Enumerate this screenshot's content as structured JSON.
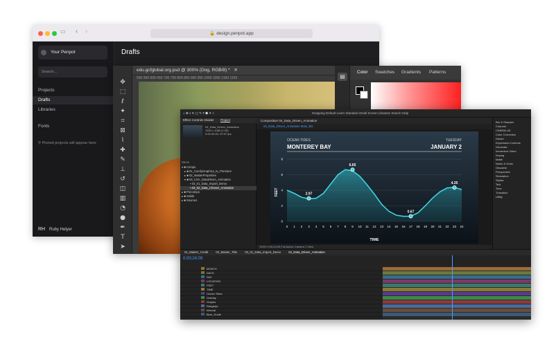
{
  "browser": {
    "url": "design.penpot.app",
    "accent_dots": [
      "#ff5f57",
      "#febc2e",
      "#28c840"
    ]
  },
  "penpot": {
    "team": "Your Penpot",
    "search_placeholder": "Search...",
    "nav": [
      "Projects",
      "Drafts",
      "Libraries"
    ],
    "fonts_label": "Fonts",
    "pinned_text": "Pinned projects will appear here",
    "page_title": "Drafts",
    "user_initials": "RH",
    "user_name": "Ruby Helyer"
  },
  "photoshop": {
    "tab_title": "edu.gcfglobal.org.psd @ 300% (Dog, RGB/8) *",
    "ruler": "500   550   600   650   700   750   800   850   900   950   1000   1050   1100   1150",
    "panel_tabs": [
      "Color",
      "Swatches",
      "Gradients",
      "Patterns"
    ]
  },
  "after_effects": {
    "menu": "Snapping   Default   Learn   Standard   Small Screen   Libraries   Search Help",
    "project_tab": "Project",
    "effect_controls": "Effect Controls Divider",
    "file_name": "04_Data_Driven_Animation",
    "file_info": [
      "1920 x 1080 (1.00)",
      "0:00:30:00, 29.97 fps"
    ],
    "tree": [
      "Name",
      "Comps",
      "01_ComfyGraphics_to_Premiere",
      "02_MasterProperties",
      "03_CSV_DataDriven_Animation",
      "03_01_Data_Import_Demo",
      "03_02_Data_Chosen_Animation",
      "Precomps",
      "Solids",
      "Sources"
    ],
    "comp_tab": "Composition 04_Data_Driven_Animation",
    "comp_subtabs": "04_Data_Driven_Animation  Main_BG",
    "right_panel": [
      "Brn & Sharpen",
      "Channel",
      "CINEMA 4D",
      "Color Correction",
      "Distort",
      "Expression Controls",
      "Generate",
      "Immersive Video",
      "Keying",
      "Matte",
      "Noise & Grain",
      "Obsolete",
      "Perspective",
      "Simulation",
      "Stylize",
      "Text",
      "Time",
      "Transition",
      "Utility"
    ],
    "timeline_tabs": [
      "01_Master_Credit",
      "02_Master_Title",
      "03_01_Data_Import_Demo",
      "04_Data_Driven_Animation"
    ],
    "timecode": "0;00;24;09",
    "layers": [
      "MONTH",
      "DAYS",
      "DAY",
      "LOCATION",
      "FEET",
      "TIME",
      "Ocean Tides",
      "Overlay",
      "Graphs",
      "Range(s)",
      "Interval",
      "Blue_Guide"
    ],
    "bottom_bar": "100%   0;00;24;09   Full   Active Camera   1 View"
  },
  "chart_data": {
    "type": "area",
    "title": "OCEAN TIDES",
    "subtitle": "MONTEREY BAY",
    "date_label": "TUESDAY",
    "date": "JANUARY 2",
    "xlabel": "TIME",
    "ylabel": "FEET",
    "x": [
      0,
      1,
      2,
      3,
      4,
      5,
      6,
      7,
      8,
      9,
      10,
      11,
      12,
      13,
      14,
      15,
      16,
      17,
      18,
      19,
      20,
      21,
      22,
      23,
      24
    ],
    "y": [
      4.0,
      3.6,
      3.1,
      2.9,
      2.97,
      3.6,
      4.8,
      6.0,
      6.65,
      6.5,
      5.8,
      4.7,
      3.5,
      2.2,
      1.3,
      0.8,
      0.65,
      0.67,
      1.1,
      2.0,
      3.0,
      3.8,
      4.3,
      4.35,
      4.1
    ],
    "labels": [
      {
        "x": 3,
        "y": 2.97,
        "text": "2.97"
      },
      {
        "x": 9,
        "y": 6.65,
        "text": "6.65"
      },
      {
        "x": 17,
        "y": 0.67,
        "text": "0.67"
      },
      {
        "x": 23,
        "y": 4.35,
        "text": "4.35"
      }
    ],
    "yticks": [
      0,
      2,
      4,
      6,
      8
    ],
    "ylim": [
      0,
      8
    ],
    "xlim": [
      0,
      24
    ],
    "line_color": "#3fd3e0",
    "grid": true
  }
}
